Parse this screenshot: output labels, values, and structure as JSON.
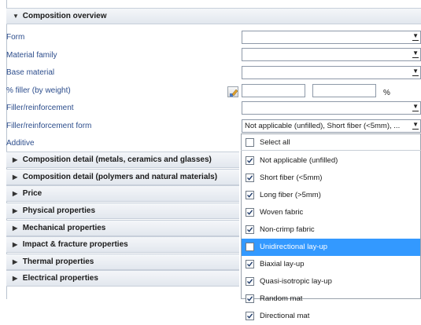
{
  "sections": {
    "composition_overview": {
      "title": "Composition overview"
    },
    "collapsed": [
      "Composition detail (metals, ceramics and glasses)",
      "Composition detail (polymers and natural materials)",
      "Price",
      "Physical properties",
      "Mechanical properties",
      "Impact & fracture properties",
      "Thermal properties",
      "Electrical properties"
    ]
  },
  "fields": {
    "form": "Form",
    "material_family": "Material family",
    "base_material": "Base material",
    "filler_weight": "% filler (by weight)",
    "filler_reinforcement": "Filler/reinforcement",
    "filler_reinforcement_form": "Filler/reinforcement form",
    "additive": "Additive",
    "percent_unit": "%",
    "filler_form_value": "Not applicable (unfilled), Short fiber (<5mm), ..."
  },
  "dropdown": {
    "select_all": "Select all",
    "options": [
      {
        "label": "Not applicable (unfilled)",
        "checked": true
      },
      {
        "label": "Short fiber (<5mm)",
        "checked": true
      },
      {
        "label": "Long fiber (>5mm)",
        "checked": true
      },
      {
        "label": "Woven fabric",
        "checked": true
      },
      {
        "label": "Non-crimp fabric",
        "checked": true
      },
      {
        "label": "Unidirectional lay-up",
        "checked": false
      },
      {
        "label": "Biaxial lay-up",
        "checked": true
      },
      {
        "label": "Quasi-isotropic lay-up",
        "checked": true
      },
      {
        "label": "Random mat",
        "checked": true
      },
      {
        "label": "Directional mat",
        "checked": true
      }
    ]
  },
  "colors": {
    "label_blue": "#2c4d8c",
    "highlight": "#3399ff"
  }
}
